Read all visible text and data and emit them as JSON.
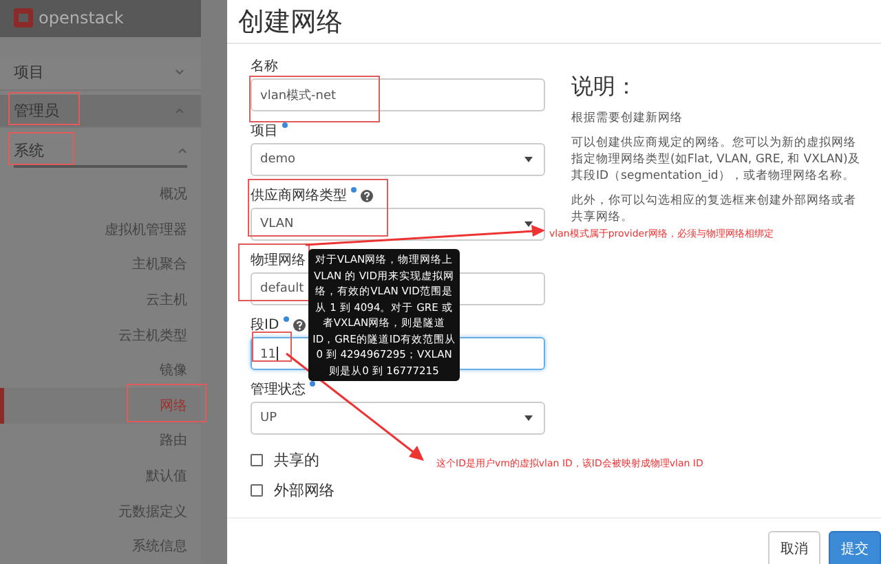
{
  "sidebar": {
    "logo": "openstack",
    "items": [
      {
        "label": "项目",
        "expanded": false,
        "selected": false
      },
      {
        "label": "管理员",
        "expanded": true,
        "selected": true,
        "children": [
          {
            "label": "系统",
            "expanded": true,
            "children": [
              {
                "label": "概况",
                "selected": false
              },
              {
                "label": "虚拟机管理器",
                "selected": false
              },
              {
                "label": "主机聚合",
                "selected": false
              },
              {
                "label": "云主机",
                "selected": false
              },
              {
                "label": "云主机类型",
                "selected": false
              },
              {
                "label": "镜像",
                "selected": false
              },
              {
                "label": "网络",
                "selected": true
              },
              {
                "label": "路由",
                "selected": false
              },
              {
                "label": "默认值",
                "selected": false
              },
              {
                "label": "元数据定义",
                "selected": false
              },
              {
                "label": "系统信息",
                "selected": false
              }
            ]
          }
        ]
      }
    ]
  },
  "dialog": {
    "title": "创建网络",
    "fields": [
      {
        "kind": "text",
        "label": "名称",
        "required": false,
        "help": false,
        "value": "vlan模式-net",
        "focused": false
      },
      {
        "kind": "select",
        "label": "项目",
        "required": true,
        "help": false,
        "value": "demo",
        "focused": false
      },
      {
        "kind": "select",
        "label": "供应商网络类型",
        "required": true,
        "help": true,
        "value": "VLAN",
        "focused": false
      },
      {
        "kind": "text",
        "label": "物理网络",
        "value": "default",
        "focused": false
      },
      {
        "kind": "text",
        "label": "段ID",
        "required": true,
        "help": true,
        "value": "11",
        "focused": true
      },
      {
        "kind": "select",
        "label": "管理状态",
        "required": true,
        "help": false,
        "value": "UP",
        "focused": false
      },
      {
        "kind": "checkbox",
        "label": "共享的",
        "checked": false
      },
      {
        "kind": "checkbox",
        "label": "外部网络",
        "checked": false
      }
    ],
    "description": {
      "heading": "说明：",
      "paragraphs": [
        "根据需要创建新网络",
        "可以创建供应商规定的网络。您可以为新的虚拟网络指定物理网络类型(如Flat, VLAN, GRE, 和 VXLAN)及其段ID（segmentation_id），或者物理网络名称。",
        "此外，你可以勾选相应的复选框来创建外部网络或者共享网络。"
      ]
    },
    "tooltip": "对于VLAN网络，物理网络上 VLAN 的 VID用来实现虚拟网络，有效的VLAN VID范围是从 1 到 4094。对于 GRE 或者VXLAN网络，则是隧道ID，GRE的隧道ID有效范围从0 到 4294967295；VXLAN则是从0 到 16777215",
    "buttons": [
      {
        "label": "取消",
        "kind": "default"
      },
      {
        "label": "提交",
        "kind": "primary"
      }
    ]
  },
  "annotations": [
    "vlan模式属于provider网络，必须与物理网络相绑定",
    "这个ID是用户vm的虚拟vlan ID，该ID会被映射成物理vlan ID"
  ]
}
